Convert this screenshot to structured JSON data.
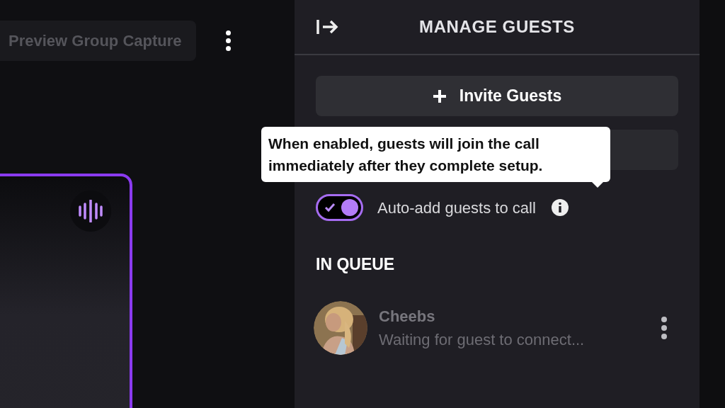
{
  "toolbar": {
    "preview_button": "Preview Group Capture"
  },
  "video_tile": {
    "selected": true,
    "speaking": true
  },
  "panel": {
    "title": "MANAGE GUESTS",
    "invite_button": "Invite Guests",
    "tooltip": "When enabled, guests will join the call immediately after they complete setup.",
    "auto_add": {
      "label": "Auto-add guests to call",
      "on": true
    },
    "queue_heading": "IN QUEUE",
    "guests": [
      {
        "name": "Cheebs",
        "status": "Waiting for guest to connect..."
      }
    ]
  }
}
